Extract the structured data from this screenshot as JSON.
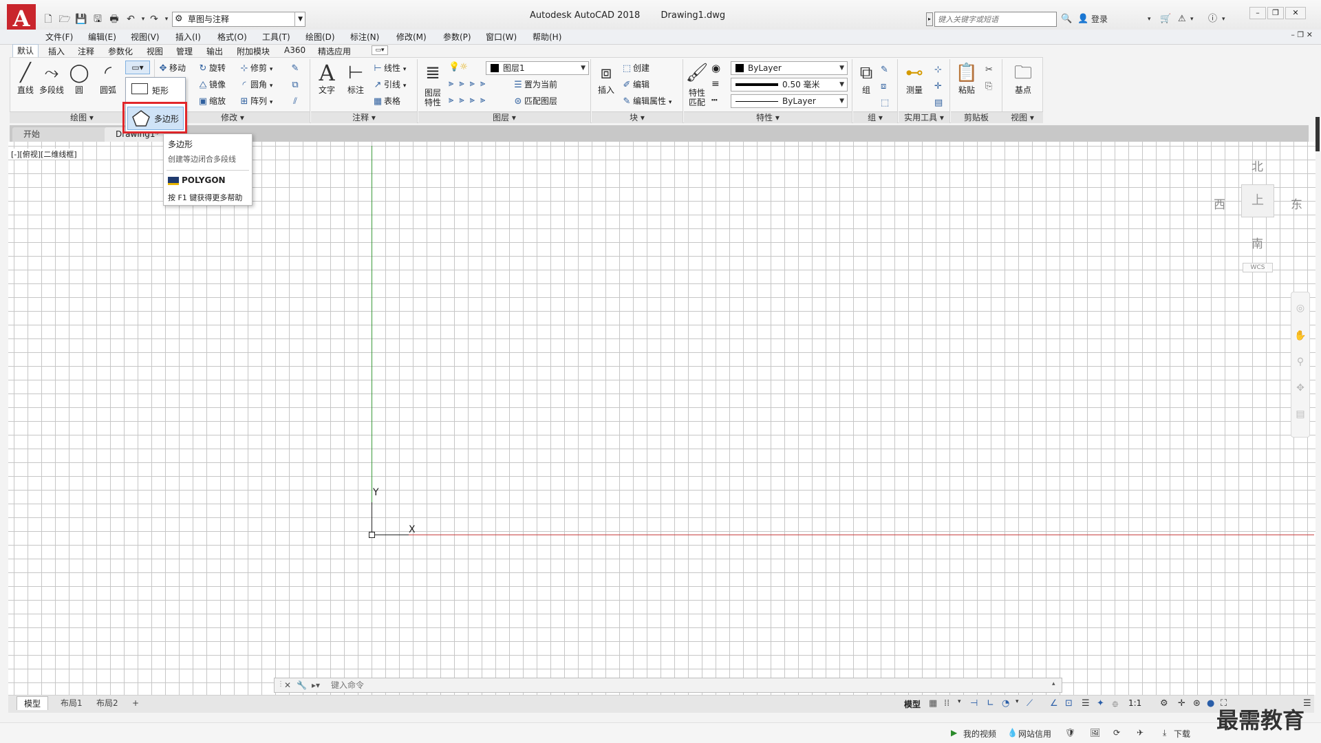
{
  "titlebar": {
    "app_title": "Autodesk AutoCAD 2018",
    "file_name": "Drawing1.dwg",
    "workspace": "草图与注释",
    "search_placeholder": "键入关键字或短语",
    "login": "登录"
  },
  "menu": [
    "文件(F)",
    "编辑(E)",
    "视图(V)",
    "插入(I)",
    "格式(O)",
    "工具(T)",
    "绘图(D)",
    "标注(N)",
    "修改(M)",
    "参数(P)",
    "窗口(W)",
    "帮助(H)"
  ],
  "ribbon_tabs": [
    "默认",
    "插入",
    "注释",
    "参数化",
    "视图",
    "管理",
    "输出",
    "附加模块",
    "A360",
    "精选应用"
  ],
  "ribbon": {
    "draw": {
      "line": "直线",
      "polyline": "多段线",
      "circle": "圆",
      "arc": "圆弧",
      "panel": "绘图"
    },
    "modify": {
      "move": "移动",
      "rotate": "旋转",
      "trim": "修剪",
      "copy": "制",
      "mirror": "镜像",
      "fillet": "圆角",
      "stretch": "伸",
      "scale": "缩放",
      "array": "阵列",
      "panel": "修改"
    },
    "annotation": {
      "text": "文字",
      "dimension": "标注",
      "linear": "线性",
      "leader": "引线",
      "table": "表格",
      "panel": "注释"
    },
    "layers": {
      "layer_props_1": "图层",
      "layer_props_2": "特性",
      "current_layer": "图层1",
      "set_current": "置为当前",
      "match_layer": "匹配图层",
      "panel": "图层"
    },
    "block": {
      "insert": "插入",
      "create": "创建",
      "edit": "编辑",
      "edit_attr": "编辑属性",
      "panel": "块"
    },
    "properties": {
      "match_1": "特性",
      "match_2": "匹配",
      "color": "ByLayer",
      "lineweight": "0.50 毫米",
      "linetype": "ByLayer",
      "panel": "特性"
    },
    "groups": {
      "group": "组",
      "panel": "组"
    },
    "utilities": {
      "measure": "测量",
      "panel": "实用工具"
    },
    "clipboard": {
      "paste": "粘贴",
      "panel": "剪贴板"
    },
    "view": {
      "base": "基点",
      "panel": "视图"
    }
  },
  "dropdown": {
    "rectangle": "矩形",
    "polygon": "多边形"
  },
  "tooltip": {
    "title": "多边形",
    "description": "创建等边闭合多段线",
    "command": "POLYGON",
    "help": "按 F1 键获得更多帮助"
  },
  "file_tabs": {
    "start": "开始",
    "drawing": "Drawing1*"
  },
  "viewport_label": "[-][俯视][二维线框]",
  "ucs": {
    "y": "Y",
    "x": "X"
  },
  "viewcube": {
    "north": "北",
    "south": "南",
    "east": "东",
    "west": "西",
    "top": "上",
    "wcs": "WCS"
  },
  "command_line": {
    "placeholder": "键入命令"
  },
  "layout_tabs": {
    "model": "模型",
    "layout1": "布局1",
    "layout2": "布局2",
    "add": "+"
  },
  "status": {
    "model": "模型",
    "scale": "1:1"
  },
  "bottom_strip": {
    "videos": "我的视频",
    "credit": "网站信用",
    "download": "下载"
  },
  "watermark": "最需教育"
}
